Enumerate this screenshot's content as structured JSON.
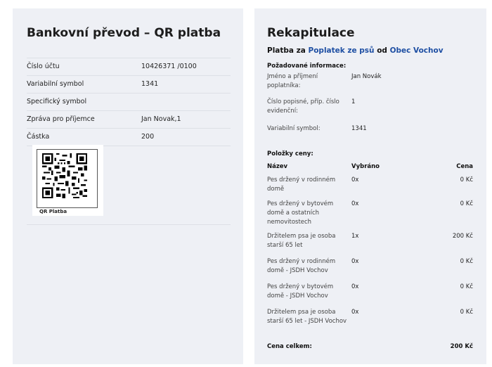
{
  "bank": {
    "title": "Bankovní převod – QR platba",
    "rows": [
      {
        "label": "Číslo účtu",
        "value": "10426371 /0100"
      },
      {
        "label": "Variabilní symbol",
        "value": "1341"
      },
      {
        "label": "Specifický symbol",
        "value": ""
      },
      {
        "label": "Zpráva pro příjemce",
        "value": "Jan Novak,1"
      },
      {
        "label": "Částka",
        "value": "200"
      }
    ],
    "qr_caption": "QR Platba"
  },
  "recap": {
    "title": "Rekapitulace",
    "subtitle_prefix": "Platba za ",
    "subtitle_fee": "Poplatek ze psů",
    "subtitle_mid": " od ",
    "subtitle_org": "Obec Vochov",
    "required_heading": "Požadované informace:",
    "required": [
      {
        "label": "Jméno a příjmení poplatníka:",
        "value": "Jan Novák"
      },
      {
        "label": "Číslo popisné, příp. číslo evidenční:",
        "value": "1"
      },
      {
        "label": "Variabilní symbol:",
        "value": "1341"
      }
    ],
    "items_heading": "Položky ceny:",
    "columns": {
      "name": "Název",
      "selected": "Vybráno",
      "price": "Cena"
    },
    "items": [
      {
        "name": "Pes držený v rodinném domě",
        "selected": "0x",
        "price": "0 Kč"
      },
      {
        "name": "Pes držený v bytovém domě a ostatních nemovitostech",
        "selected": "0x",
        "price": "0 Kč"
      },
      {
        "name": "Držitelem psa je osoba starší 65 let",
        "selected": "1x",
        "price": "200 Kč"
      },
      {
        "name": "Pes držený v rodinném domě - JSDH Vochov",
        "selected": "0x",
        "price": "0 Kč"
      },
      {
        "name": "Pes držený v bytovém domě - JSDH Vochov",
        "selected": "0x",
        "price": "0 Kč"
      },
      {
        "name": "Držitelem psa je osoba starší 65 let - JSDH Vochov",
        "selected": "0x",
        "price": "0 Kč"
      }
    ],
    "total_label": "Cena celkem:",
    "total_value": "200 Kč"
  }
}
